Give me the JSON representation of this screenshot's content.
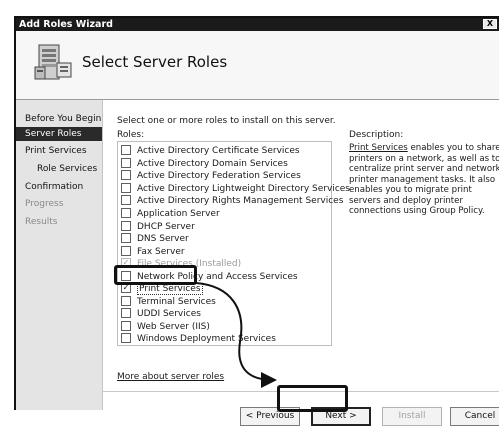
{
  "window": {
    "title": "Add Roles Wizard",
    "close_glyph": "X"
  },
  "header": {
    "title": "Select Server Roles",
    "icon": "server-roles-icon"
  },
  "nav": {
    "items": [
      {
        "label": "Before You Begin",
        "state": "normal"
      },
      {
        "label": "Server Roles",
        "state": "active"
      },
      {
        "label": "Print Services",
        "state": "normal"
      },
      {
        "label": "Role Services",
        "state": "normal",
        "indent": true
      },
      {
        "label": "Confirmation",
        "state": "normal"
      },
      {
        "label": "Progress",
        "state": "disabled"
      },
      {
        "label": "Results",
        "state": "disabled"
      }
    ]
  },
  "main": {
    "instructions": "Select one or more roles to install on this server.",
    "roles_label": "Roles:",
    "roles": [
      {
        "label": "Active Directory Certificate Services",
        "checked": false
      },
      {
        "label": "Active Directory Domain Services",
        "checked": false
      },
      {
        "label": "Active Directory Federation Services",
        "checked": false
      },
      {
        "label": "Active Directory Lightweight Directory Services",
        "checked": false
      },
      {
        "label": "Active Directory Rights Management Services",
        "checked": false
      },
      {
        "label": "Application Server",
        "checked": false
      },
      {
        "label": "DHCP Server",
        "checked": false
      },
      {
        "label": "DNS Server",
        "checked": false
      },
      {
        "label": "Fax Server",
        "checked": false
      },
      {
        "label": "File Services  (Installed)",
        "checked": true,
        "disabled": true
      },
      {
        "label": "Network Policy and Access Services",
        "checked": false
      },
      {
        "label": "Print Services",
        "checked": true,
        "selected": true
      },
      {
        "label": "Terminal Services",
        "checked": false
      },
      {
        "label": "UDDI Services",
        "checked": false
      },
      {
        "label": "Web Server (IIS)",
        "checked": false
      },
      {
        "label": "Windows Deployment Services",
        "checked": false
      }
    ],
    "more_link": "More about server roles",
    "description_title": "Description:",
    "description_link": "Print Services",
    "description_text": " enables you to share printers on a network, as well as to centralize print server and network printer management tasks. It also enables you to migrate print servers and deploy printer connections using Group Policy."
  },
  "footer": {
    "previous_label": "< Previous",
    "next_label": "Next >",
    "install_label": "Install",
    "cancel_label": "Cancel"
  }
}
